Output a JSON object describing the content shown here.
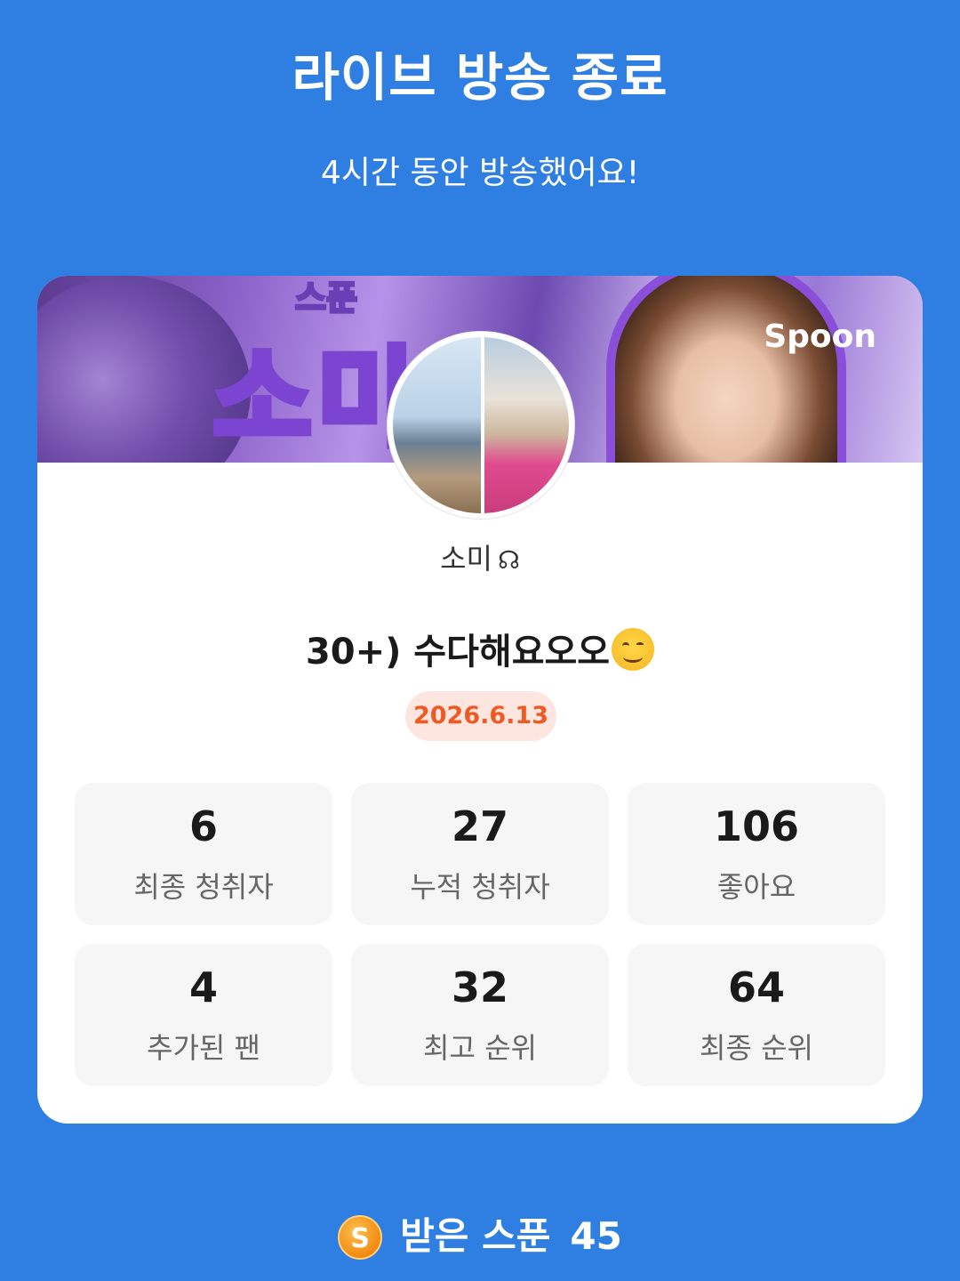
{
  "header": {
    "title": "라이브 방송 종료",
    "subtitle": "4시간 동안 방송했어요!"
  },
  "banner": {
    "small_text": "스푼",
    "big_text": "소미",
    "brand": "Spoon"
  },
  "profile": {
    "nickname": "소미",
    "nickname_icon": "headphone-icon"
  },
  "live": {
    "title": "30+) 수다해요오오",
    "title_emoji": "smiling-face-icon",
    "date": "2026.6.13"
  },
  "stats": [
    {
      "value": "6",
      "label": "최종 청취자"
    },
    {
      "value": "27",
      "label": "누적 청취자"
    },
    {
      "value": "106",
      "label": "좋아요"
    },
    {
      "value": "4",
      "label": "추가된 팬"
    },
    {
      "value": "32",
      "label": "최고 순위"
    },
    {
      "value": "64",
      "label": "최종 순위"
    }
  ],
  "footer": {
    "coin_letter": "S",
    "label": "받은 스푼",
    "count": "45"
  },
  "colors": {
    "background": "#2f7fe3",
    "card": "#ffffff",
    "date_badge_bg": "#fde6df",
    "date_badge_text": "#ef5a24",
    "stat_box_bg": "#f6f6f6"
  }
}
